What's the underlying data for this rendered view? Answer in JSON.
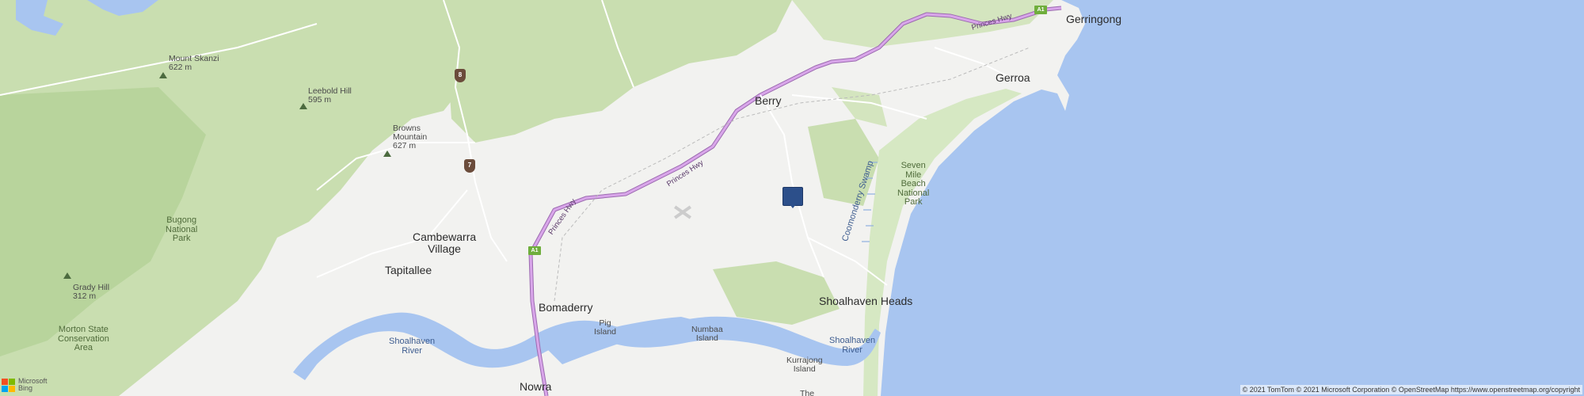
{
  "map": {
    "colors": {
      "ocean": "#a8c5f0",
      "land": "#f2f2f0",
      "forest": "#c9deb0",
      "forest_dark": "#b8d49c",
      "river": "#a8c5f0",
      "highway": "#c792d8",
      "highway_edge": "#9c6bb0",
      "road": "#ffffff",
      "pin": "#2c4f8a"
    },
    "towns": {
      "gerringong": "Gerringong",
      "gerroa": "Gerroa",
      "berry": "Berry",
      "cambewarra_1": "Cambewarra",
      "cambewarra_2": "Village",
      "tapitallee": "Tapitallee",
      "bomaderry": "Bomaderry",
      "nowra": "Nowra",
      "shoalhaven_heads": "Shoalhaven Heads"
    },
    "peaks": {
      "mount_skanzi_name": "Mount Skanzi",
      "mount_skanzi_elev": "622 m",
      "leebold_name": "Leebold Hill",
      "leebold_elev": "595 m",
      "browns_1": "Browns",
      "browns_2": "Mountain",
      "browns_elev": "627 m",
      "grady_name": "Grady Hill",
      "grady_elev": "312 m"
    },
    "parks": {
      "bugong_1": "Bugong",
      "bugong_2": "National",
      "bugong_3": "Park",
      "morton_1": "Morton State",
      "morton_2": "Conservation",
      "morton_3": "Area",
      "seven_mile_1": "Seven",
      "seven_mile_2": "Mile",
      "seven_mile_3": "Beach",
      "seven_mile_4": "National",
      "seven_mile_5": "Park"
    },
    "water": {
      "shoalhaven_river_w_1": "Shoalhaven",
      "shoalhaven_river_w_2": "River",
      "shoalhaven_river_e_1": "Shoalhaven",
      "shoalhaven_river_e_2": "River",
      "coomonderry": "Coomonderry Swamp"
    },
    "islands": {
      "pig_1": "Pig",
      "pig_2": "Island",
      "numbaa_1": "Numbaa",
      "numbaa_2": "Island",
      "kurrajong_1": "Kurrajong",
      "kurrajong_2": "Island",
      "the": "The"
    },
    "roads": {
      "princes_hwy_1": "Princes Hwy",
      "princes_hwy_2": "Princes Hwy",
      "princes_hwy_3": "Princes Hwy",
      "shield_a1": "A1",
      "route_8": "8",
      "route_7": "7"
    },
    "branding": {
      "ms_line1": "Microsoft",
      "ms_line2": "Bing",
      "copyright": "© 2021 TomTom © 2021 Microsoft Corporation © OpenStreetMap https://www.openstreetmap.org/copyright"
    }
  }
}
